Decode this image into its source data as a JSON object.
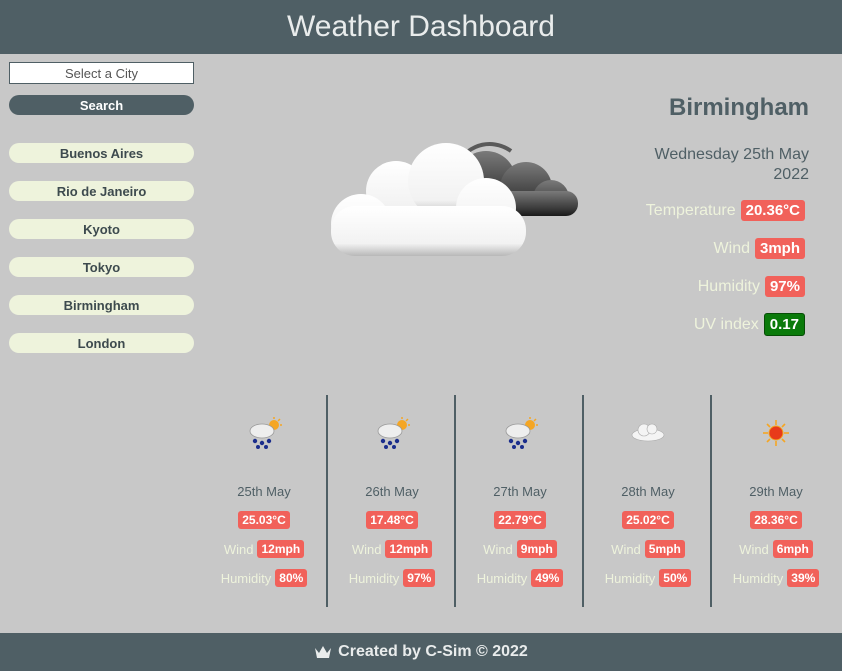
{
  "header": {
    "title": "Weather Dashboard"
  },
  "sidebar": {
    "search_placeholder": "Select a City",
    "search_label": "Search",
    "cities": [
      "Buenos Aires",
      "Rio de Janeiro",
      "Kyoto",
      "Tokyo",
      "Birmingham",
      "London"
    ]
  },
  "current": {
    "city": "Birmingham",
    "date_line1": "Wednesday 25th May",
    "date_line2": "2022",
    "icon": "cloud-with-dark-cloud-icon",
    "temperature_label": "Temperature",
    "temperature": "20.36°C",
    "wind_label": "Wind",
    "wind": "3mph",
    "humidity_label": "Humidity",
    "humidity": "97%",
    "uv_label": "UV index",
    "uv": "0.17"
  },
  "forecast": [
    {
      "date": "25th May",
      "temp": "25.03°C",
      "wind_label": "Wind",
      "wind": "12mph",
      "humidity_label": "Humidity",
      "humidity": "80%",
      "icon": "rain-sun-icon"
    },
    {
      "date": "26th May",
      "temp": "17.48°C",
      "wind_label": "Wind",
      "wind": "12mph",
      "humidity_label": "Humidity",
      "humidity": "97%",
      "icon": "rain-sun-icon"
    },
    {
      "date": "27th May",
      "temp": "22.79°C",
      "wind_label": "Wind",
      "wind": "9mph",
      "humidity_label": "Humidity",
      "humidity": "49%",
      "icon": "rain-sun-icon"
    },
    {
      "date": "28th May",
      "temp": "25.02°C",
      "wind_label": "Wind",
      "wind": "5mph",
      "humidity_label": "Humidity",
      "humidity": "50%",
      "icon": "cloud-icon"
    },
    {
      "date": "29th May",
      "temp": "28.36°C",
      "wind_label": "Wind",
      "wind": "6mph",
      "humidity_label": "Humidity",
      "humidity": "39%",
      "icon": "sun-icon"
    }
  ],
  "footer": {
    "text": "Created by C-Sim © 2022",
    "icon": "crown-icon"
  },
  "colors": {
    "header_bg": "#4f5f65",
    "page_bg": "#c8c8c8",
    "pill_red": "#f1615a",
    "uv_green": "#0a7a0a",
    "city_btn_bg": "#eef3dc"
  }
}
